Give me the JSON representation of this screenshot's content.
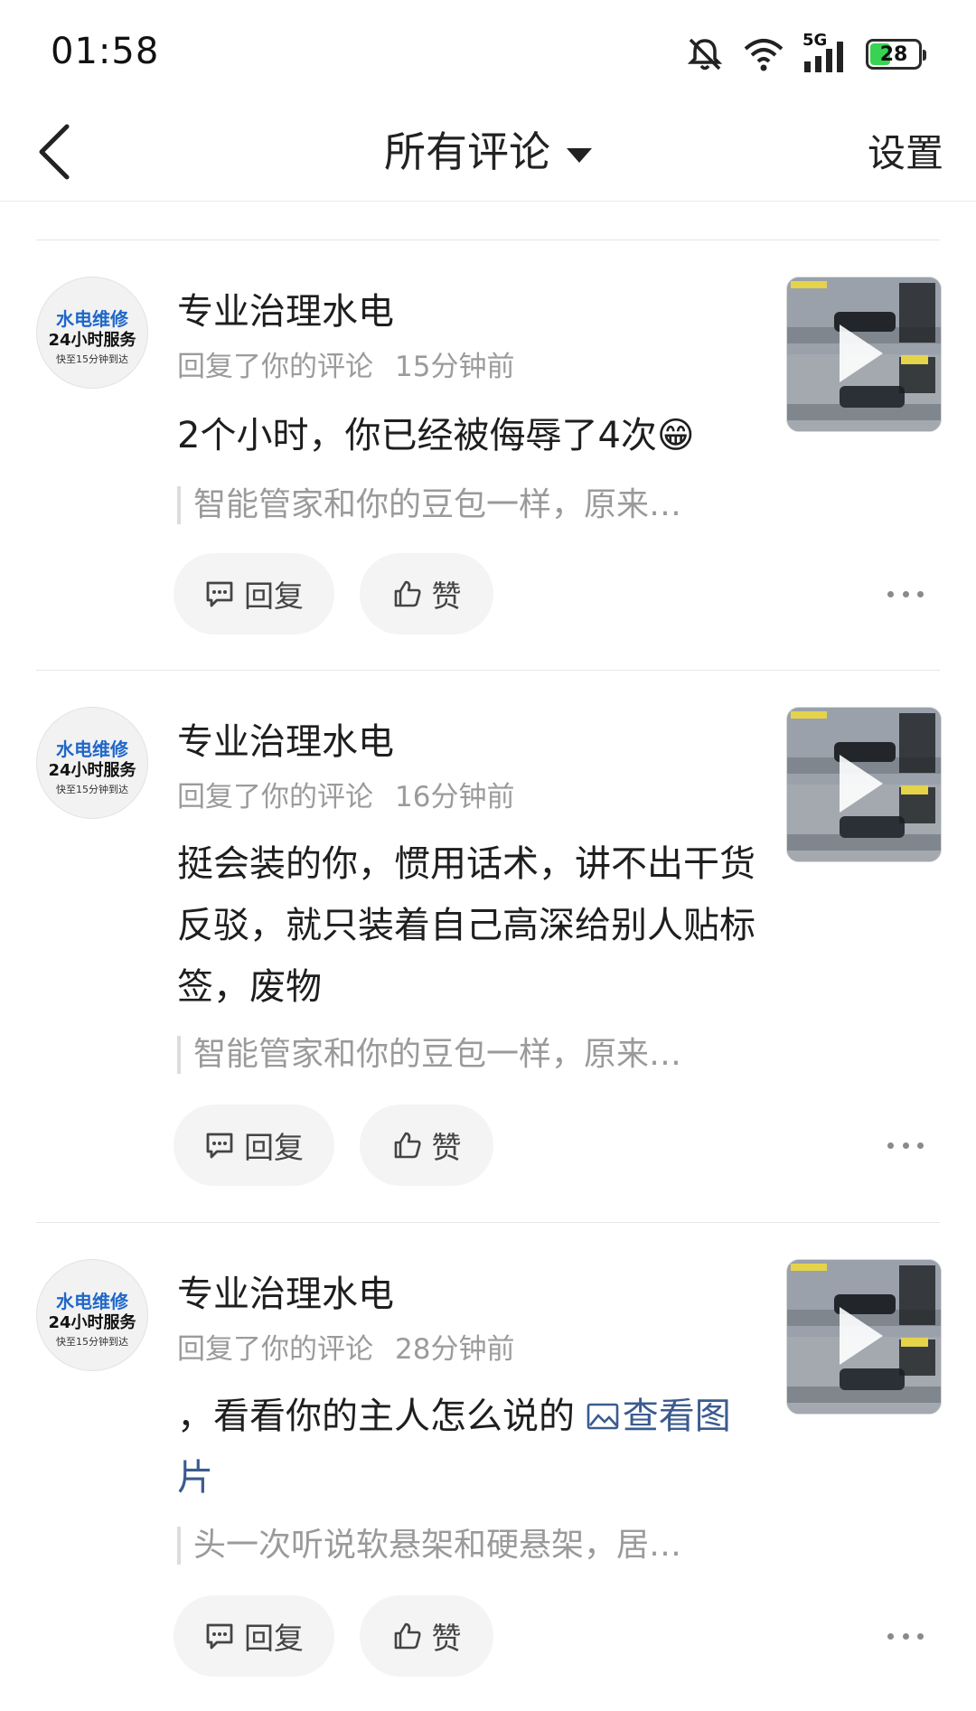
{
  "status_bar": {
    "time": "01:58",
    "network": "5G",
    "battery": "28"
  },
  "nav": {
    "title": "所有评论",
    "settings": "设置"
  },
  "colors": {
    "link": "#3b5b8f",
    "battery_fill": "#39d353",
    "meta": "#9b9b9b"
  },
  "comments": [
    {
      "user": "专业治理水电",
      "avatar_text": [
        "水电维修",
        "24小时服务",
        "快至15分钟到达"
      ],
      "action": "回复了你的评论",
      "time": "15分钟前",
      "text": "2个小时，你已经被侮辱了4次😁",
      "quote": "智能管家和你的豆包一样，原来…",
      "reply_label": "回复",
      "like_label": "赞"
    },
    {
      "user": "专业治理水电",
      "avatar_text": [
        "水电维修",
        "24小时服务",
        "快至15分钟到达"
      ],
      "action": "回复了你的评论",
      "time": "16分钟前",
      "text": "挺会装的你，惯用话术，讲不出干货反驳，就只装着自己高深给别人贴标签，废物",
      "quote": "智能管家和你的豆包一样，原来…",
      "reply_label": "回复",
      "like_label": "赞"
    },
    {
      "user": "专业治理水电",
      "avatar_text": [
        "水电维修",
        "24小时服务",
        "快至15分钟到达"
      ],
      "action": "回复了你的评论",
      "time": "28分钟前",
      "text": "，看看你的主人怎么说的 ",
      "link_text": "查看图片",
      "quote": "头一次听说软悬架和硬悬架，居…",
      "reply_label": "回复",
      "like_label": "赞"
    }
  ]
}
